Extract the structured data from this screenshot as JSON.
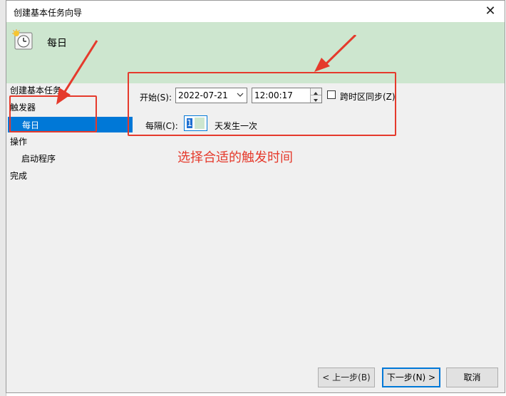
{
  "window": {
    "title": "创建基本任务向导",
    "close_glyph": "✕"
  },
  "header": {
    "title": "每日"
  },
  "nav": {
    "items": [
      {
        "label": "创建基本任务"
      },
      {
        "label": "触发器"
      },
      {
        "label": "每日"
      },
      {
        "label": "操作"
      },
      {
        "label": "启动程序"
      },
      {
        "label": "完成"
      }
    ],
    "selected_index": 2
  },
  "form": {
    "start_label": "开始(S):",
    "date_value": "2022-07-21",
    "time_value": "12:00:17",
    "timezone_label": "跨时区同步(Z)",
    "timezone_checked": false,
    "every_label": "每隔(C):",
    "every_value": "1",
    "every_suffix": "天发生一次"
  },
  "annotation": {
    "text": "选择合适的触发时间",
    "color": "#e53a2c"
  },
  "buttons": {
    "back": "< 上一步(B)",
    "next": "下一步(N) >",
    "cancel": "取消"
  },
  "colors": {
    "header_bg": "#cde6cf",
    "selection": "#0078d7",
    "annotation_red": "#e53a2c"
  }
}
